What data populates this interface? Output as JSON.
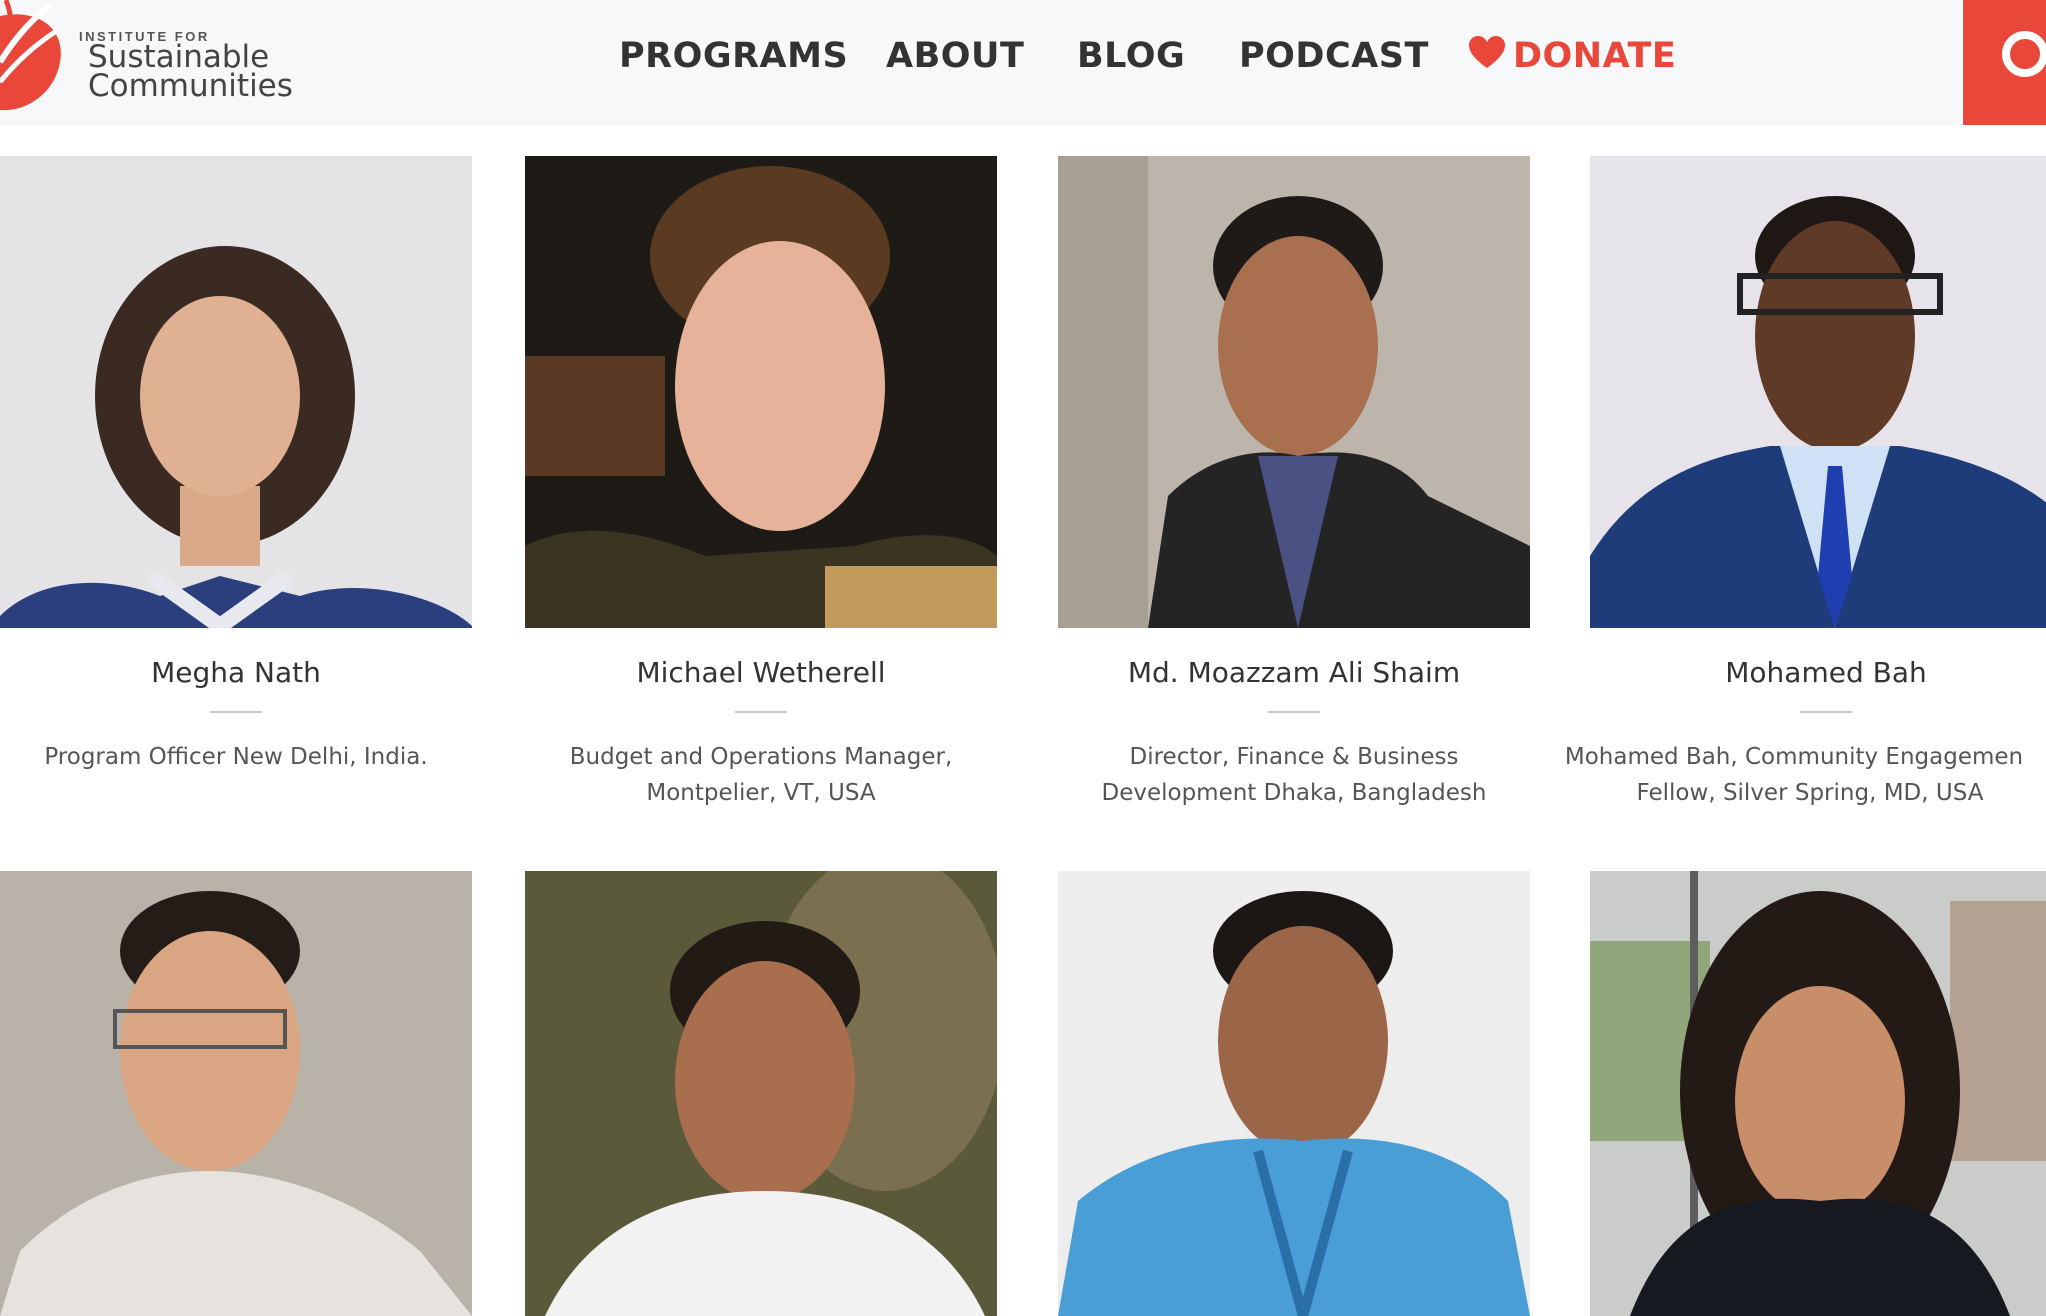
{
  "brand": {
    "small": "INSTITUTE FOR",
    "line1": "Sustainable",
    "line2": "Communities",
    "color": "#e8473a"
  },
  "nav": {
    "items": [
      "PROGRAMS",
      "ABOUT",
      "BLOG",
      "PODCAST"
    ],
    "donate": "DONATE",
    "donate_icon": "heart-icon",
    "corner_icon": "search-icon"
  },
  "staff": [
    {
      "name": "Megha Nath",
      "role_lines": [
        "Program Officer New Delhi, India.",
        ""
      ]
    },
    {
      "name": "Michael Wetherell",
      "role_lines": [
        "Budget and Operations Manager,",
        "Montpelier, VT, USA"
      ]
    },
    {
      "name": "Md. Moazzam Ali Shaim",
      "role_lines": [
        "Director, Finance & Business",
        "Development Dhaka, Bangladesh"
      ]
    },
    {
      "name": "Mohamed Bah",
      "role_lines": [
        "Mohamed Bah, Community Engagemen",
        "Fellow, Silver Spring, MD, USA"
      ]
    }
  ]
}
